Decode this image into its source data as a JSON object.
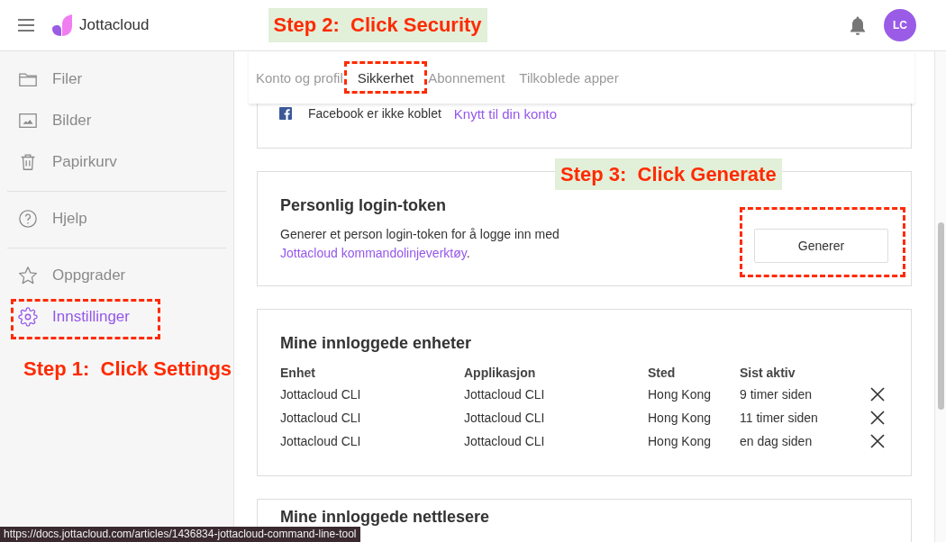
{
  "header": {
    "app_name": "Jottacloud",
    "callout": {
      "text": "Step 2:  Click Security",
      "backdrop": true
    },
    "avatar_initials": "LC"
  },
  "sidebar": {
    "groups": [
      {
        "items": [
          {
            "kind": "files",
            "label": "Filer",
            "selected": false,
            "highlighted": false
          },
          {
            "kind": "photos",
            "label": "Bilder",
            "selected": false,
            "highlighted": false
          },
          {
            "kind": "trash",
            "label": "Papirkurv",
            "selected": false,
            "highlighted": false
          }
        ]
      },
      {
        "items": [
          {
            "kind": "help",
            "label": "Hjelp",
            "selected": false,
            "highlighted": false
          }
        ]
      },
      {
        "items": [
          {
            "kind": "upgrade",
            "label": "Oppgrader",
            "selected": false,
            "highlighted": false
          },
          {
            "kind": "settings",
            "label": "Innstillinger",
            "selected": true,
            "highlighted": true
          }
        ]
      }
    ],
    "callout": {
      "text": "Step 1:  Click Settings",
      "backdrop": false
    }
  },
  "tabs": [
    {
      "label": "Konto og profil",
      "selected": false,
      "highlighted": false
    },
    {
      "label": "Sikkerhet",
      "selected": true,
      "highlighted": true
    },
    {
      "label": "Abonnement",
      "selected": false,
      "highlighted": false
    },
    {
      "label": "Tilkoblede apper",
      "selected": false,
      "highlighted": false
    }
  ],
  "facebook_panel": {
    "status": "Facebook er ikke koblet",
    "link": "Knytt til din konto"
  },
  "token_panel": {
    "title": "Personlig login-token",
    "description": "Generer et person login-token for å logge inn med",
    "link": "Jottacloud kommandolinjeverktøy",
    "description_end": ".",
    "button": {
      "label": "Generer",
      "highlighted": true
    },
    "callout": {
      "text": "Step 3:  Click Generate",
      "backdrop": true
    }
  },
  "devices_panel": {
    "title": "Mine innloggede enheter",
    "columns": [
      "Enhet",
      "Applikasjon",
      "Sted",
      "Sist aktiv"
    ],
    "rows": [
      {
        "cells": [
          "Jottacloud CLI",
          "Jottacloud CLI",
          "Hong Kong",
          "9 timer siden"
        ]
      },
      {
        "cells": [
          "Jottacloud CLI",
          "Jottacloud CLI",
          "Hong Kong",
          "11 timer siden"
        ]
      },
      {
        "cells": [
          "Jottacloud CLI",
          "Jottacloud CLI",
          "Hong Kong",
          "en dag siden"
        ]
      }
    ]
  },
  "browsers_panel": {
    "title": "Mine innloggede nettlesere"
  },
  "status_url": "https://docs.jottacloud.com/articles/1436834-jottacloud-command-line-tool"
}
